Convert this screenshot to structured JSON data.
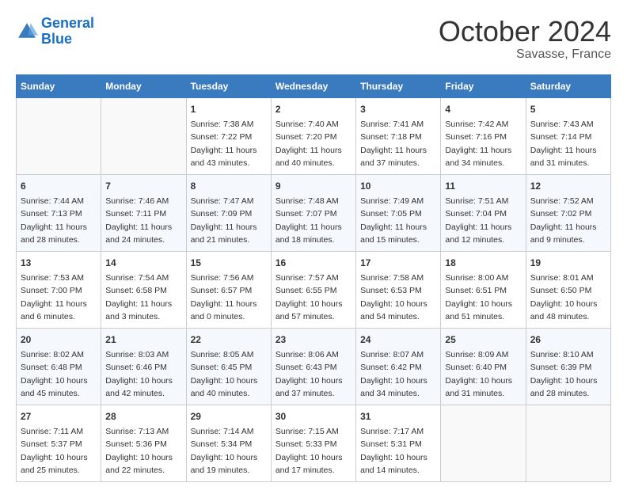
{
  "header": {
    "logo_line1": "General",
    "logo_line2": "Blue",
    "month": "October 2024",
    "location": "Savasse, France"
  },
  "columns": [
    "Sunday",
    "Monday",
    "Tuesday",
    "Wednesday",
    "Thursday",
    "Friday",
    "Saturday"
  ],
  "weeks": [
    [
      {
        "day": "",
        "sunrise": "",
        "sunset": "",
        "daylight": ""
      },
      {
        "day": "",
        "sunrise": "",
        "sunset": "",
        "daylight": ""
      },
      {
        "day": "1",
        "sunrise": "Sunrise: 7:38 AM",
        "sunset": "Sunset: 7:22 PM",
        "daylight": "Daylight: 11 hours and 43 minutes."
      },
      {
        "day": "2",
        "sunrise": "Sunrise: 7:40 AM",
        "sunset": "Sunset: 7:20 PM",
        "daylight": "Daylight: 11 hours and 40 minutes."
      },
      {
        "day": "3",
        "sunrise": "Sunrise: 7:41 AM",
        "sunset": "Sunset: 7:18 PM",
        "daylight": "Daylight: 11 hours and 37 minutes."
      },
      {
        "day": "4",
        "sunrise": "Sunrise: 7:42 AM",
        "sunset": "Sunset: 7:16 PM",
        "daylight": "Daylight: 11 hours and 34 minutes."
      },
      {
        "day": "5",
        "sunrise": "Sunrise: 7:43 AM",
        "sunset": "Sunset: 7:14 PM",
        "daylight": "Daylight: 11 hours and 31 minutes."
      }
    ],
    [
      {
        "day": "6",
        "sunrise": "Sunrise: 7:44 AM",
        "sunset": "Sunset: 7:13 PM",
        "daylight": "Daylight: 11 hours and 28 minutes."
      },
      {
        "day": "7",
        "sunrise": "Sunrise: 7:46 AM",
        "sunset": "Sunset: 7:11 PM",
        "daylight": "Daylight: 11 hours and 24 minutes."
      },
      {
        "day": "8",
        "sunrise": "Sunrise: 7:47 AM",
        "sunset": "Sunset: 7:09 PM",
        "daylight": "Daylight: 11 hours and 21 minutes."
      },
      {
        "day": "9",
        "sunrise": "Sunrise: 7:48 AM",
        "sunset": "Sunset: 7:07 PM",
        "daylight": "Daylight: 11 hours and 18 minutes."
      },
      {
        "day": "10",
        "sunrise": "Sunrise: 7:49 AM",
        "sunset": "Sunset: 7:05 PM",
        "daylight": "Daylight: 11 hours and 15 minutes."
      },
      {
        "day": "11",
        "sunrise": "Sunrise: 7:51 AM",
        "sunset": "Sunset: 7:04 PM",
        "daylight": "Daylight: 11 hours and 12 minutes."
      },
      {
        "day": "12",
        "sunrise": "Sunrise: 7:52 AM",
        "sunset": "Sunset: 7:02 PM",
        "daylight": "Daylight: 11 hours and 9 minutes."
      }
    ],
    [
      {
        "day": "13",
        "sunrise": "Sunrise: 7:53 AM",
        "sunset": "Sunset: 7:00 PM",
        "daylight": "Daylight: 11 hours and 6 minutes."
      },
      {
        "day": "14",
        "sunrise": "Sunrise: 7:54 AM",
        "sunset": "Sunset: 6:58 PM",
        "daylight": "Daylight: 11 hours and 3 minutes."
      },
      {
        "day": "15",
        "sunrise": "Sunrise: 7:56 AM",
        "sunset": "Sunset: 6:57 PM",
        "daylight": "Daylight: 11 hours and 0 minutes."
      },
      {
        "day": "16",
        "sunrise": "Sunrise: 7:57 AM",
        "sunset": "Sunset: 6:55 PM",
        "daylight": "Daylight: 10 hours and 57 minutes."
      },
      {
        "day": "17",
        "sunrise": "Sunrise: 7:58 AM",
        "sunset": "Sunset: 6:53 PM",
        "daylight": "Daylight: 10 hours and 54 minutes."
      },
      {
        "day": "18",
        "sunrise": "Sunrise: 8:00 AM",
        "sunset": "Sunset: 6:51 PM",
        "daylight": "Daylight: 10 hours and 51 minutes."
      },
      {
        "day": "19",
        "sunrise": "Sunrise: 8:01 AM",
        "sunset": "Sunset: 6:50 PM",
        "daylight": "Daylight: 10 hours and 48 minutes."
      }
    ],
    [
      {
        "day": "20",
        "sunrise": "Sunrise: 8:02 AM",
        "sunset": "Sunset: 6:48 PM",
        "daylight": "Daylight: 10 hours and 45 minutes."
      },
      {
        "day": "21",
        "sunrise": "Sunrise: 8:03 AM",
        "sunset": "Sunset: 6:46 PM",
        "daylight": "Daylight: 10 hours and 42 minutes."
      },
      {
        "day": "22",
        "sunrise": "Sunrise: 8:05 AM",
        "sunset": "Sunset: 6:45 PM",
        "daylight": "Daylight: 10 hours and 40 minutes."
      },
      {
        "day": "23",
        "sunrise": "Sunrise: 8:06 AM",
        "sunset": "Sunset: 6:43 PM",
        "daylight": "Daylight: 10 hours and 37 minutes."
      },
      {
        "day": "24",
        "sunrise": "Sunrise: 8:07 AM",
        "sunset": "Sunset: 6:42 PM",
        "daylight": "Daylight: 10 hours and 34 minutes."
      },
      {
        "day": "25",
        "sunrise": "Sunrise: 8:09 AM",
        "sunset": "Sunset: 6:40 PM",
        "daylight": "Daylight: 10 hours and 31 minutes."
      },
      {
        "day": "26",
        "sunrise": "Sunrise: 8:10 AM",
        "sunset": "Sunset: 6:39 PM",
        "daylight": "Daylight: 10 hours and 28 minutes."
      }
    ],
    [
      {
        "day": "27",
        "sunrise": "Sunrise: 7:11 AM",
        "sunset": "Sunset: 5:37 PM",
        "daylight": "Daylight: 10 hours and 25 minutes."
      },
      {
        "day": "28",
        "sunrise": "Sunrise: 7:13 AM",
        "sunset": "Sunset: 5:36 PM",
        "daylight": "Daylight: 10 hours and 22 minutes."
      },
      {
        "day": "29",
        "sunrise": "Sunrise: 7:14 AM",
        "sunset": "Sunset: 5:34 PM",
        "daylight": "Daylight: 10 hours and 19 minutes."
      },
      {
        "day": "30",
        "sunrise": "Sunrise: 7:15 AM",
        "sunset": "Sunset: 5:33 PM",
        "daylight": "Daylight: 10 hours and 17 minutes."
      },
      {
        "day": "31",
        "sunrise": "Sunrise: 7:17 AM",
        "sunset": "Sunset: 5:31 PM",
        "daylight": "Daylight: 10 hours and 14 minutes."
      },
      {
        "day": "",
        "sunrise": "",
        "sunset": "",
        "daylight": ""
      },
      {
        "day": "",
        "sunrise": "",
        "sunset": "",
        "daylight": ""
      }
    ]
  ]
}
